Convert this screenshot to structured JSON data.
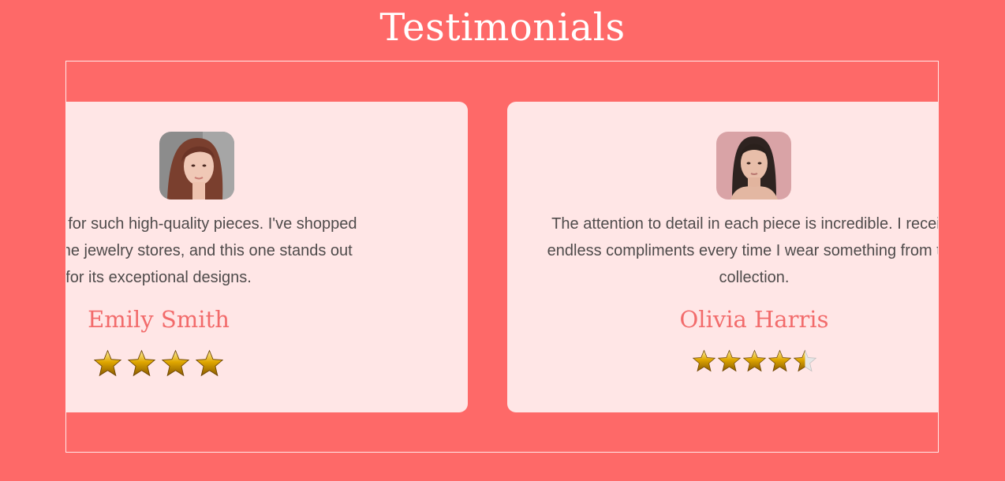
{
  "section": {
    "title": "Testimonials"
  },
  "colors": {
    "background": "#fe6968",
    "card": "#ffe6e6",
    "name": "#f26b6b",
    "text": "#4f4b4b",
    "star_gold": "#e0a800"
  },
  "testimonials": [
    {
      "quote_line_1": "Amazing value for such high-quality pieces. I've shopped",
      "quote_line_2": "at various online jewelry stores, and this one stands out",
      "quote_line_3": "for its exceptional designs.",
      "name": "Emily Smith",
      "rating": 4,
      "max_rating": 5,
      "avatar_icon": "woman-portrait-photo"
    },
    {
      "quote_line_1": "The attention to detail in each piece is incredible. I receive",
      "quote_line_2": "endless compliments every time I wear something from this",
      "quote_line_3": "collection.",
      "name": "Olivia Harris",
      "rating": 4.5,
      "max_rating": 5,
      "avatar_icon": "woman-portrait-photo"
    }
  ]
}
